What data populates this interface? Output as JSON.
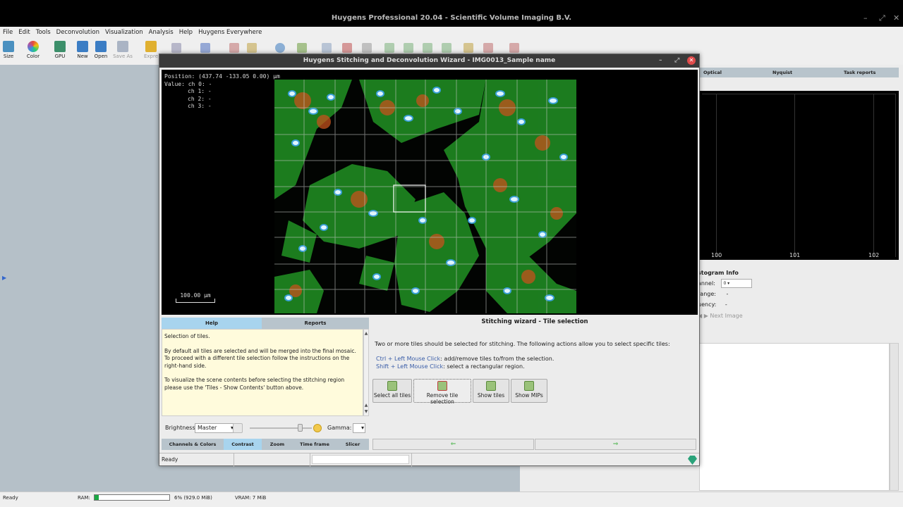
{
  "app": {
    "title": "Huygens Professional 20.04 - Scientific Volume Imaging B.V.",
    "menu": [
      "File",
      "Edit",
      "Tools",
      "Deconvolution",
      "Visualization",
      "Analysis",
      "Help",
      "Huygens Everywhere"
    ],
    "toolbar": [
      {
        "label": "Size",
        "icon": "size-icon",
        "color": "#4a90c0"
      },
      {
        "label": "Color",
        "icon": "color-wheel-icon",
        "color": "#e7a43a"
      },
      {
        "label": "GPU",
        "icon": "gpu-icon",
        "color": "#3c8f6a"
      },
      {
        "label": "New",
        "icon": "new-icon",
        "color": "#3b7dc4"
      },
      {
        "label": "Open",
        "icon": "open-icon",
        "color": "#3b7dc4"
      },
      {
        "label": "Save As",
        "icon": "save-as-icon",
        "color": "#aab4c4"
      },
      {
        "label": "Expre",
        "icon": "express-icon",
        "color": "#e0b030"
      }
    ]
  },
  "right_panel": {
    "tabs": [
      "Optical",
      "Nyquist",
      "Task reports"
    ],
    "histogram_ticks": [
      "100",
      "101",
      "102"
    ],
    "histogram_info_title": "stogram Info",
    "channel_label": "annel:",
    "channel_value": "0",
    "range_label": "range:",
    "range_value": "-",
    "frequency_label": "uency:",
    "frequency_value": "-",
    "next_image": "Next Image"
  },
  "status": {
    "ready": "Ready",
    "ram_label": "RAM:",
    "ram_fraction": 0.06,
    "ram_text": "6% (929.0 MiB)",
    "vram_text": "VRAM: 7 MiB"
  },
  "dialog": {
    "title": "Huygens Stitching and Deconvolution Wizard  - IMG0013_Sample name",
    "viewer": {
      "position": "Position: (437.74 -133.05 0.00) μm",
      "value": "Value: ch 0: -",
      "ch1": "ch 1: -",
      "ch2": "ch 2: -",
      "ch3": "ch 3: -",
      "scale": "100.00 μm"
    },
    "left_tabs": [
      "Help",
      "Reports"
    ],
    "help_paragraphs": [
      "Selection of tiles.",
      "By default all tiles are selected and will be merged into the final mosaic. To proceed with a different tile selection follow the instructions on the right-hand side.",
      "To visualize the scene contents before selecting the stitching region please use the 'Tiles - Show Contents' button above."
    ],
    "wizard_title": "Stitching wizard - Tile selection",
    "wizard_text": "Two or more tiles should be selected for stitching.   The following actions allow you to select specific tiles:",
    "actions": [
      {
        "key": "Ctrl + Left Mouse Click",
        "desc": ": add/remove tiles to/from the selection."
      },
      {
        "key": "Shift + Left Mouse Click",
        "desc": ": select a rectangular region."
      }
    ],
    "buttons": [
      "Select all tiles",
      "Remove tile selection",
      "Show tiles",
      "Show MIPs"
    ],
    "brightness_label": "Brightness:",
    "brightness_value": "Master",
    "gamma_label": "Gamma:",
    "bottom_tabs": [
      "Channels & Colors",
      "Contrast",
      "Zoom",
      "Time frame",
      "Slicer"
    ],
    "status_ready": "Ready"
  }
}
